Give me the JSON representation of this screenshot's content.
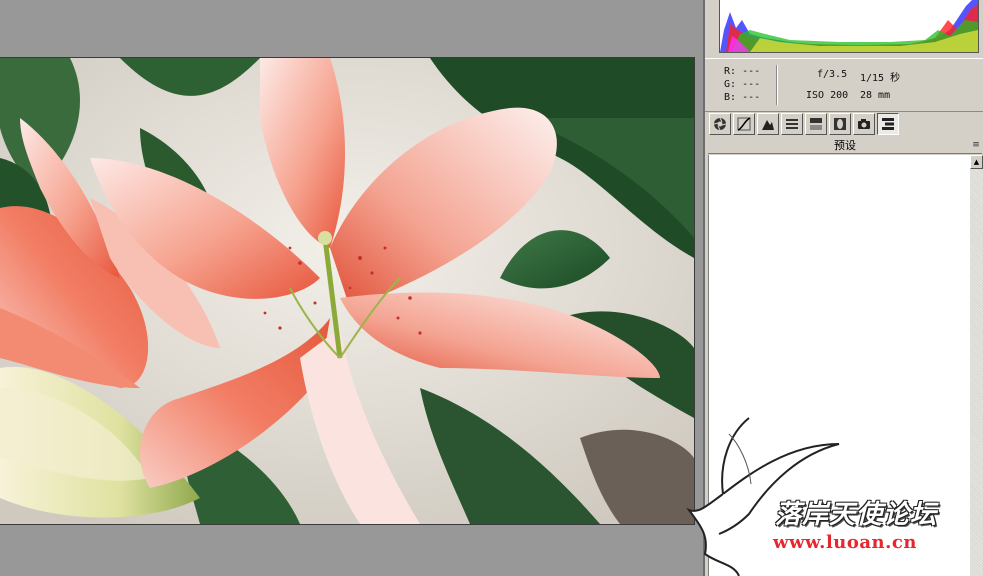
{
  "readout": {
    "r_label": "R:",
    "g_label": "G:",
    "b_label": "B:",
    "r_value": "---",
    "g_value": "---",
    "b_value": "---",
    "aperture": "f/3.5",
    "shutter": "1/15 秒",
    "iso": "ISO 200",
    "focal": "28 mm"
  },
  "tabs": [
    {
      "icon": "basic-aperture-icon"
    },
    {
      "icon": "tone-curve-icon"
    },
    {
      "icon": "detail-icon"
    },
    {
      "icon": "hsl-icon"
    },
    {
      "icon": "split-toning-icon"
    },
    {
      "icon": "lens-corrections-icon"
    },
    {
      "icon": "camera-calibration-icon"
    },
    {
      "icon": "presets-icon"
    }
  ],
  "active_tab": 7,
  "section": {
    "title": "预设",
    "menu_glyph": "≡"
  },
  "scrollbar": {
    "up_glyph": "▲"
  },
  "watermark": {
    "chinese": "落岸天使论坛",
    "url": "www.luoan.cn"
  },
  "colors": {
    "panel_bg": "#d4d0c8",
    "canvas_bg": "#989898",
    "watermark_url": "#e8262e"
  }
}
